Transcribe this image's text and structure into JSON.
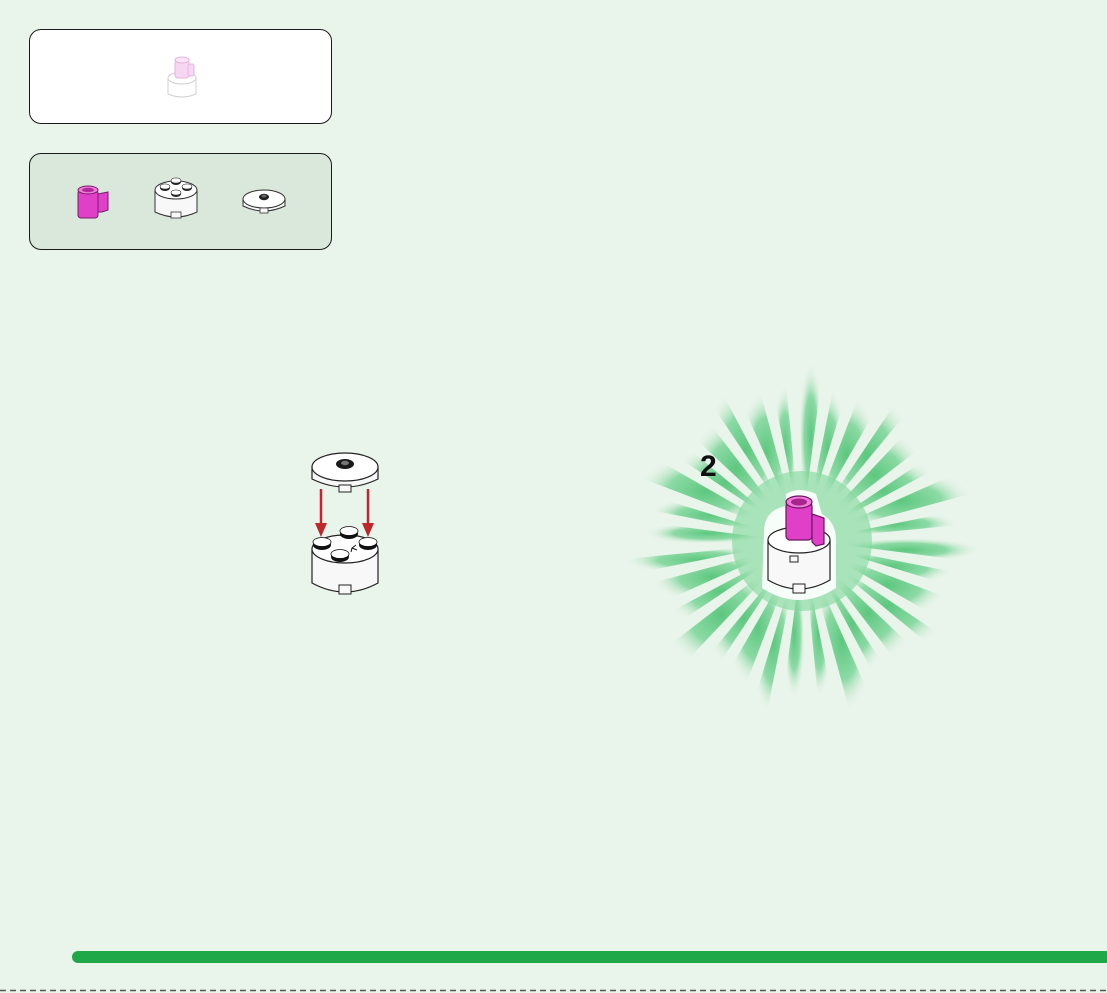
{
  "step": {
    "number": "2"
  },
  "model_preview": {
    "icon": "round-brick-with-cup-icon"
  },
  "parts_list": {
    "items": [
      {
        "icon": "pink-cup-icon",
        "color": "#e040c8"
      },
      {
        "icon": "round-brick-2x2-icon",
        "color": "#ffffff"
      },
      {
        "icon": "round-tile-with-stud-icon",
        "color": "#ffffff"
      }
    ]
  },
  "colors": {
    "page_background": "#e9f4ea",
    "parts_panel_background": "#d9e8da",
    "starburst": "#6fd08c",
    "arrow": "#c0262c",
    "progress_bar": "#1fa848",
    "pink_part": "#e040c8"
  }
}
